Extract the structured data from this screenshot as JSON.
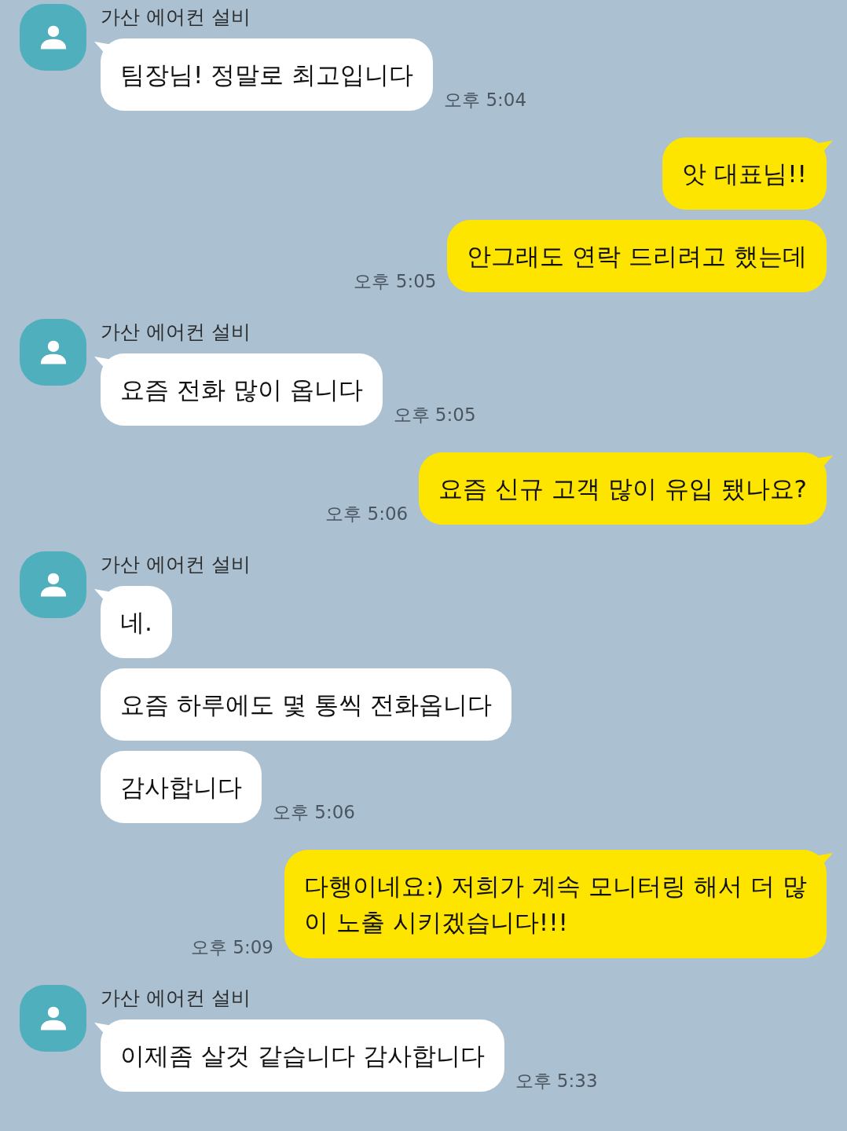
{
  "messages": [
    {
      "kind": "received",
      "sender": "가산 에어컨 설비",
      "bubbles": [
        "팀장님! 정말로 최고입니다"
      ],
      "time": "오후 5:04"
    },
    {
      "kind": "sent",
      "bubbles": [
        "앗 대표님!!",
        "안그래도 연락 드리려고 했는데"
      ],
      "time": "오후 5:05"
    },
    {
      "kind": "received",
      "sender": "가산 에어컨 설비",
      "bubbles": [
        "요즘 전화 많이 옵니다"
      ],
      "time": "오후 5:05"
    },
    {
      "kind": "sent",
      "bubbles": [
        "요즘 신규 고객 많이 유입 됐나요?"
      ],
      "time": "오후 5:06"
    },
    {
      "kind": "received",
      "sender": "가산 에어컨 설비",
      "bubbles": [
        "네.",
        "요즘 하루에도 몇 통씩 전화옵니다",
        "감사합니다"
      ],
      "time": "오후 5:06"
    },
    {
      "kind": "sent",
      "bubbles": [
        "다행이네요:) 저희가 계속 모니터링 해서 더 많이 노출 시키겠습니다!!!"
      ],
      "time": "오후 5:09"
    },
    {
      "kind": "received",
      "sender": "가산 에어컨 설비",
      "bubbles": [
        "이제좀 살것 같습니다 감사합니다"
      ],
      "time": "오후 5:33"
    }
  ]
}
